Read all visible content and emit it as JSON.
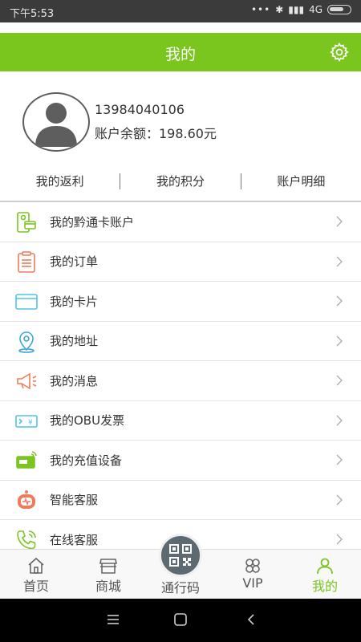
{
  "status_bar": {
    "time": "下午5:53",
    "network": "4G"
  },
  "header": {
    "title": "我的"
  },
  "profile": {
    "phone": "13984040106",
    "balance": "账户余额：198.60元"
  },
  "tabs": [
    "我的返利",
    "我的积分",
    "账户明细"
  ],
  "menu": [
    {
      "label": "我的黔通卡账户",
      "icon": "card-account-icon",
      "color": "#7ac51e"
    },
    {
      "label": "我的订单",
      "icon": "order-clipboard-icon",
      "color": "#f07b5a"
    },
    {
      "label": "我的卡片",
      "icon": "card-icon",
      "color": "#4fc4ea"
    },
    {
      "label": "我的地址",
      "icon": "location-pin-icon",
      "color": "#3fa7d6"
    },
    {
      "label": "我的消息",
      "icon": "megaphone-icon",
      "color": "#f07b5a"
    },
    {
      "label": "我的OBU发票",
      "icon": "invoice-ticket-icon",
      "color": "#4fc4ea"
    },
    {
      "label": "我的充值设备",
      "icon": "recharge-device-icon",
      "color": "#7ac51e"
    },
    {
      "label": "智能客服",
      "icon": "robot-icon",
      "color": "#f07b5a"
    },
    {
      "label": "在线客服",
      "icon": "phone-icon",
      "color": "#7ac51e"
    }
  ],
  "bottom_nav": [
    {
      "label": "首页",
      "icon": "home-icon"
    },
    {
      "label": "商城",
      "icon": "store-icon"
    },
    {
      "label": "通行码",
      "icon": "qr-code-icon"
    },
    {
      "label": "VIP",
      "icon": "vip-icon"
    },
    {
      "label": "我的",
      "icon": "user-icon",
      "active": true
    }
  ],
  "colors": {
    "accent": "#7ac51e",
    "status_bar": "#3b3b3b",
    "nav_center": "#5c6a71"
  }
}
